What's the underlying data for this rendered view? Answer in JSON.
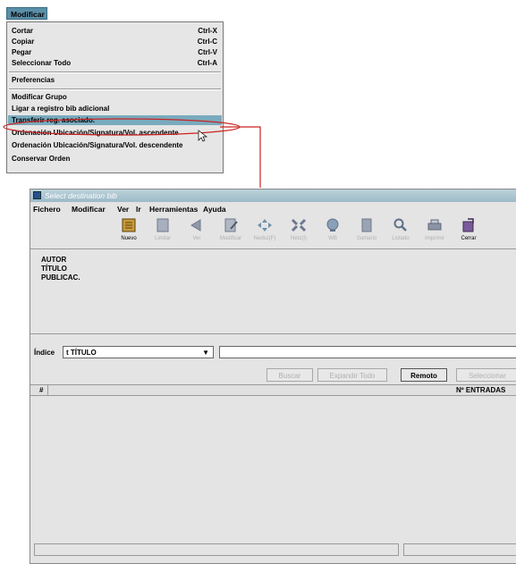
{
  "menu": {
    "title": "Modificar",
    "items": [
      {
        "label": "Cortar",
        "shortcut": "Ctrl-X"
      },
      {
        "label": "Copiar",
        "shortcut": "Ctrl-C"
      },
      {
        "label": "Pegar",
        "shortcut": "Ctrl-V"
      },
      {
        "label": "Seleccionar Todo",
        "shortcut": "Ctrl-A"
      },
      {
        "label": "Preferencias"
      },
      {
        "label": "Modificar Grupo"
      },
      {
        "label": "Ligar a registro bib adicional"
      },
      {
        "label": "Transferir reg. asociado."
      },
      {
        "label": "Ordenación Ubicación/Signatura/Vol. ascendente"
      },
      {
        "label": "Ordenación Ubicación/Signatura/Vol. descendente"
      },
      {
        "label": "Conservar Orden"
      }
    ]
  },
  "window": {
    "title": "Select destination bib",
    "menubar": [
      "Fichero",
      "Modificar",
      "Ver",
      "Ir",
      "Herramientas",
      "Ayuda"
    ],
    "toolbar": [
      "Nuevo",
      "Limitar",
      "Ver",
      "Modificar",
      "Nedsz(F)",
      "Netz(I)",
      "WB",
      "Sumario",
      "Listado",
      "Imprimir",
      "Cerrar"
    ],
    "info_labels": [
      "AUTOR",
      "TÍTULO",
      "PUBLICAC."
    ],
    "index_label": "Índice",
    "index_value": "t TÍTULO",
    "search_value": "",
    "buttons": {
      "buscar": "Buscar",
      "expandir": "Expandir Todo",
      "remoto": "Remoto",
      "seleccionar": "Seleccionar"
    },
    "grid": {
      "col_num": "#",
      "col_entradas": "Nº ENTRADAS"
    }
  },
  "annotation_color": "#cc2222"
}
